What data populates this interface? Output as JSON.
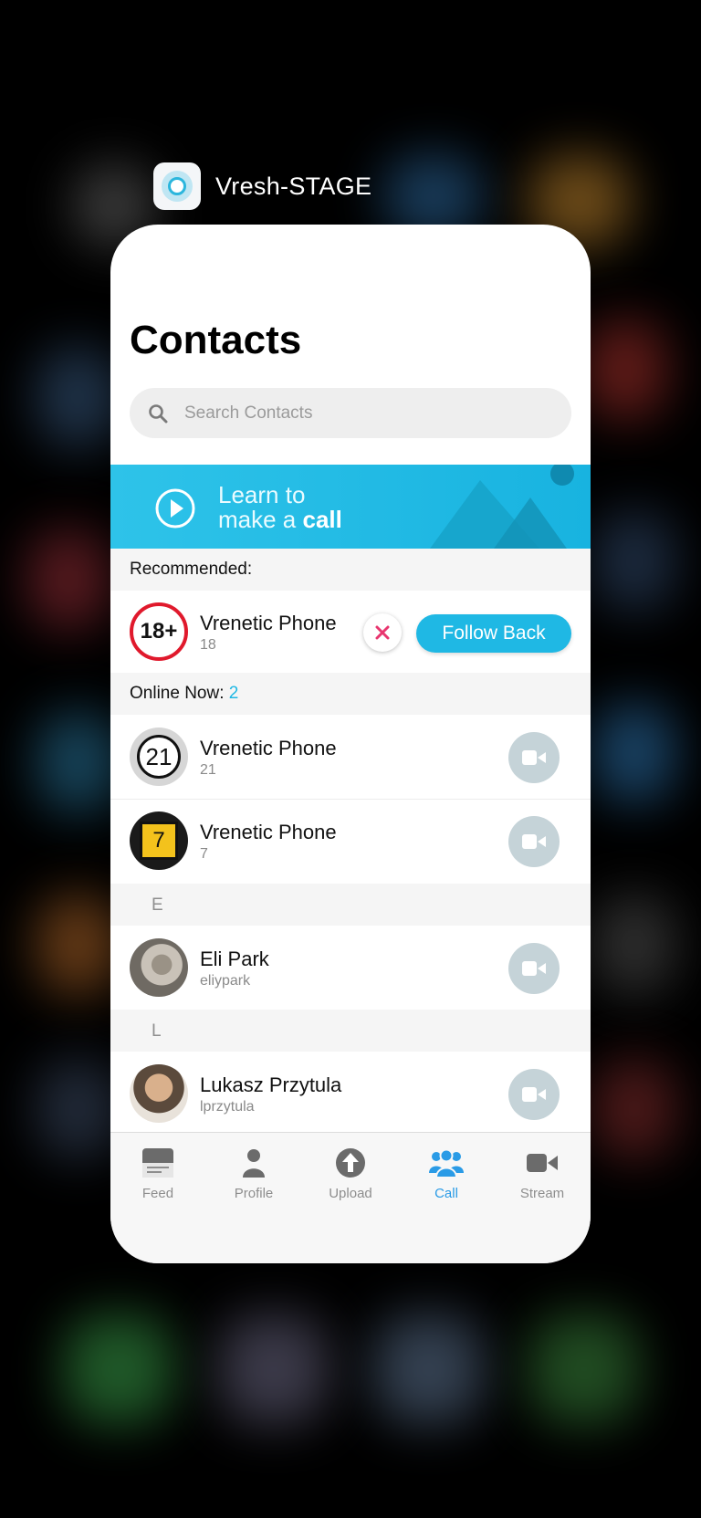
{
  "app": {
    "name": "Vresh-STAGE"
  },
  "page": {
    "title": "Contacts"
  },
  "search": {
    "placeholder": "Search Contacts"
  },
  "banner": {
    "line1": "Learn to",
    "line2_prefix": "make a ",
    "line2_bold": "call"
  },
  "recommended": {
    "label": "Recommended:",
    "contact": {
      "name": "Vrenetic Phone",
      "sub": "18",
      "avatar_text": "18+"
    },
    "follow_back_label": "Follow Back"
  },
  "online_now": {
    "label": "Online Now:",
    "count": "2",
    "contacts": [
      {
        "name": "Vrenetic Phone",
        "sub": "21",
        "avatar_text": "21"
      },
      {
        "name": "Vrenetic Phone",
        "sub": "7",
        "avatar_text": "7"
      }
    ]
  },
  "groups": [
    {
      "letter": "E",
      "contacts": [
        {
          "name": "Eli Park",
          "sub": "eliypark"
        }
      ]
    },
    {
      "letter": "L",
      "contacts": [
        {
          "name": "Lukasz Przytula",
          "sub": "lprzytula"
        }
      ]
    }
  ],
  "tabs": [
    {
      "label": "Feed",
      "icon": "feed-icon"
    },
    {
      "label": "Profile",
      "icon": "person-icon"
    },
    {
      "label": "Upload",
      "icon": "upload-icon"
    },
    {
      "label": "Call",
      "icon": "group-icon",
      "active": true
    },
    {
      "label": "Stream",
      "icon": "video-icon"
    }
  ],
  "colors": {
    "accent": "#1fb8e4",
    "active_tab": "#2a9be6",
    "dismiss": "#e8366f"
  }
}
